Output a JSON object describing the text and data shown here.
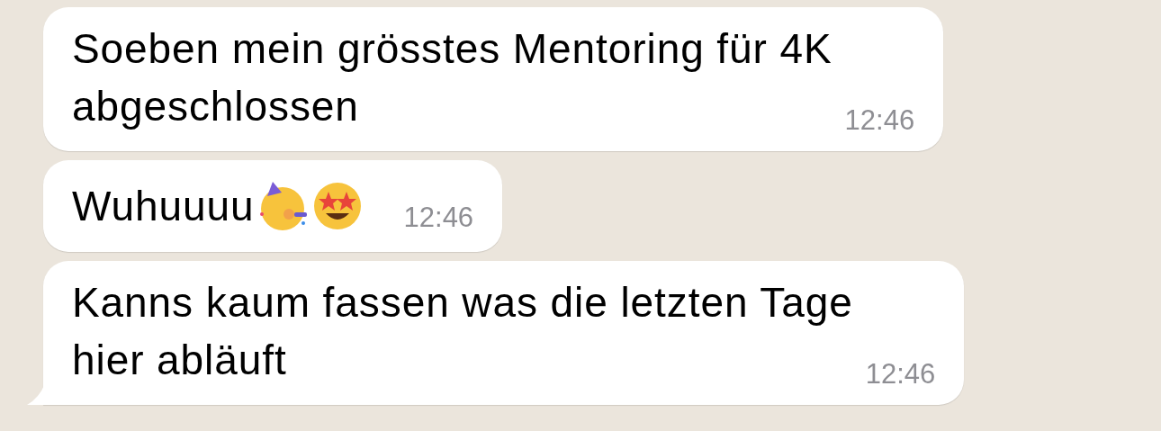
{
  "messages": [
    {
      "text": "Soeben mein grösstes Mentoring für 4K\nabgeschlossen",
      "time": "12:46",
      "emojis": false,
      "tail": false
    },
    {
      "text": "Wuhuuuu",
      "time": "12:46",
      "emojis": true,
      "tail": false
    },
    {
      "text": "Kanns kaum fassen was die letzten Tage\nhier abläuft",
      "time": "12:46",
      "emojis": false,
      "tail": true
    }
  ]
}
